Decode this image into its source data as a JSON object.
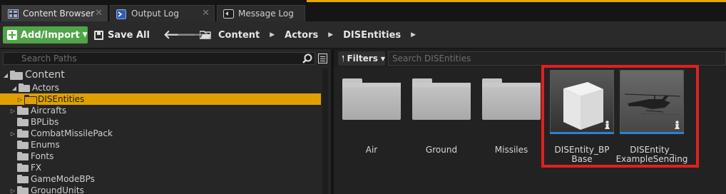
{
  "tabs": [
    {
      "label": "Content Browser",
      "active": true,
      "icon": "content-browser-icon"
    },
    {
      "label": "Output Log",
      "active": false,
      "icon": "output-log-icon"
    },
    {
      "label": "Message Log",
      "active": false,
      "icon": "message-log-icon"
    }
  ],
  "toolbar": {
    "add_import_label": "Add/Import",
    "save_all_label": "Save All",
    "breadcrumbs": [
      "Content",
      "Actors",
      "DISEntities"
    ]
  },
  "left_panel": {
    "search_placeholder": "Search Paths",
    "tree": [
      {
        "label": "Content",
        "depth": 0,
        "expanded": true
      },
      {
        "label": "Actors",
        "depth": 1,
        "expanded": true
      },
      {
        "label": "DISEntities",
        "depth": 2,
        "selected": true
      },
      {
        "label": "Aircrafts",
        "depth": 1
      },
      {
        "label": "BPLibs",
        "depth": 1
      },
      {
        "label": "CombatMissilePack",
        "depth": 1
      },
      {
        "label": "Enums",
        "depth": 1
      },
      {
        "label": "Fonts",
        "depth": 1
      },
      {
        "label": "FX",
        "depth": 1
      },
      {
        "label": "GameModeBPs",
        "depth": 1
      },
      {
        "label": "GroundUnits",
        "depth": 1
      }
    ]
  },
  "right_panel": {
    "filters_label": "Filters",
    "search_placeholder": "Search DISEntities",
    "folders": [
      "Air",
      "Ground",
      "Missiles"
    ],
    "assets": [
      {
        "line1": "DISEntity_BP",
        "line2": "Base",
        "thumbnail": "white-cube"
      },
      {
        "line1": "DISEntity_",
        "line2": "ExampleSending",
        "thumbnail": "helicopter"
      }
    ]
  },
  "colors": {
    "accent": "#e8a800",
    "add_button": "#4fa548",
    "selection": "#e0a000",
    "highlight_box": "#e02020",
    "asset_bar": "#2f7fd8"
  }
}
